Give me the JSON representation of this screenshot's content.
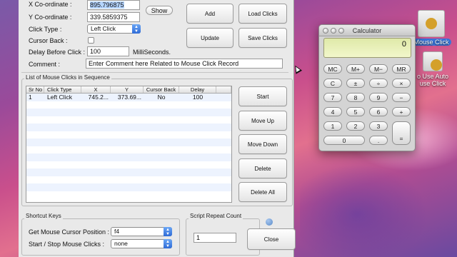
{
  "app": {
    "x_label": "X Co-ordinate :",
    "x_value": "895.796875",
    "y_label": "Y Co-ordinate :",
    "y_value": "339.5859375",
    "show_label": "Show",
    "click_type_label": "Click Type :",
    "click_type_value": "Left Click",
    "cursor_back_label": "Cursor Back :",
    "delay_label": "Delay Before Click :",
    "delay_value": "100",
    "delay_unit": "MilliSeconds.",
    "comment_label": "Comment :",
    "comment_value": "Enter Comment here Related to Mouse Click Record",
    "buttons": {
      "add": "Add",
      "load": "Load Clicks",
      "update": "Update",
      "save": "Save Clicks",
      "start": "Start",
      "move_up": "Move Up",
      "move_down": "Move Down",
      "delete": "Delete",
      "delete_all": "Delete All",
      "close": "Close"
    },
    "list_title": "List of Mouse Clicks in Sequence",
    "table": {
      "columns": [
        "Sr No",
        "Click Type",
        "X",
        "Y",
        "Cursor Back",
        "Delay"
      ],
      "rows": [
        [
          "1",
          "Left Click",
          "745.2...",
          "373.69...",
          "No",
          "100"
        ]
      ]
    },
    "shortcut_title": "Shortcut Keys",
    "get_pos_label": "Get Mouse Cursor Position :",
    "get_pos_value": "f4",
    "start_stop_label": "Start / Stop Mouse Clicks :",
    "start_stop_value": "none",
    "repeat_title": "Script Repeat Count",
    "repeat_value": "1"
  },
  "calculator": {
    "title": "Calculator",
    "display": "0",
    "keys": [
      "MC",
      "M+",
      "M−",
      "MR",
      "C",
      "±",
      "÷",
      "×",
      "7",
      "8",
      "9",
      "−",
      "4",
      "5",
      "6",
      "+",
      "1",
      "2",
      "3",
      "=",
      "0",
      "."
    ]
  },
  "desktop": {
    "icon1_label": "Mouse Click",
    "icon2_line1": "o Use Auto",
    "icon2_line2": "use Click"
  },
  "colors": {
    "accent_blue": "#2f6bd6",
    "selection": "#b5d5ff",
    "calc_display": "#e8f0b8"
  }
}
